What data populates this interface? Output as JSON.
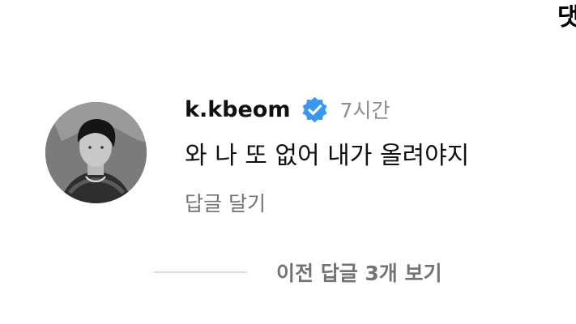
{
  "header_edge_text": "댓",
  "comment": {
    "username": "k.kbeom",
    "verified_icon": "verified-badge-icon",
    "timestamp": "7시간",
    "text": "와 나 또 없어 내가 올려야지",
    "reply_label": "답글 달기"
  },
  "replies": {
    "view_label": "이전 답글 3개 보기"
  },
  "colors": {
    "verified_blue": "#3897f0",
    "secondary_text": "#737373",
    "timestamp_text": "#8e8e8e",
    "divider": "#dcdcdc"
  }
}
